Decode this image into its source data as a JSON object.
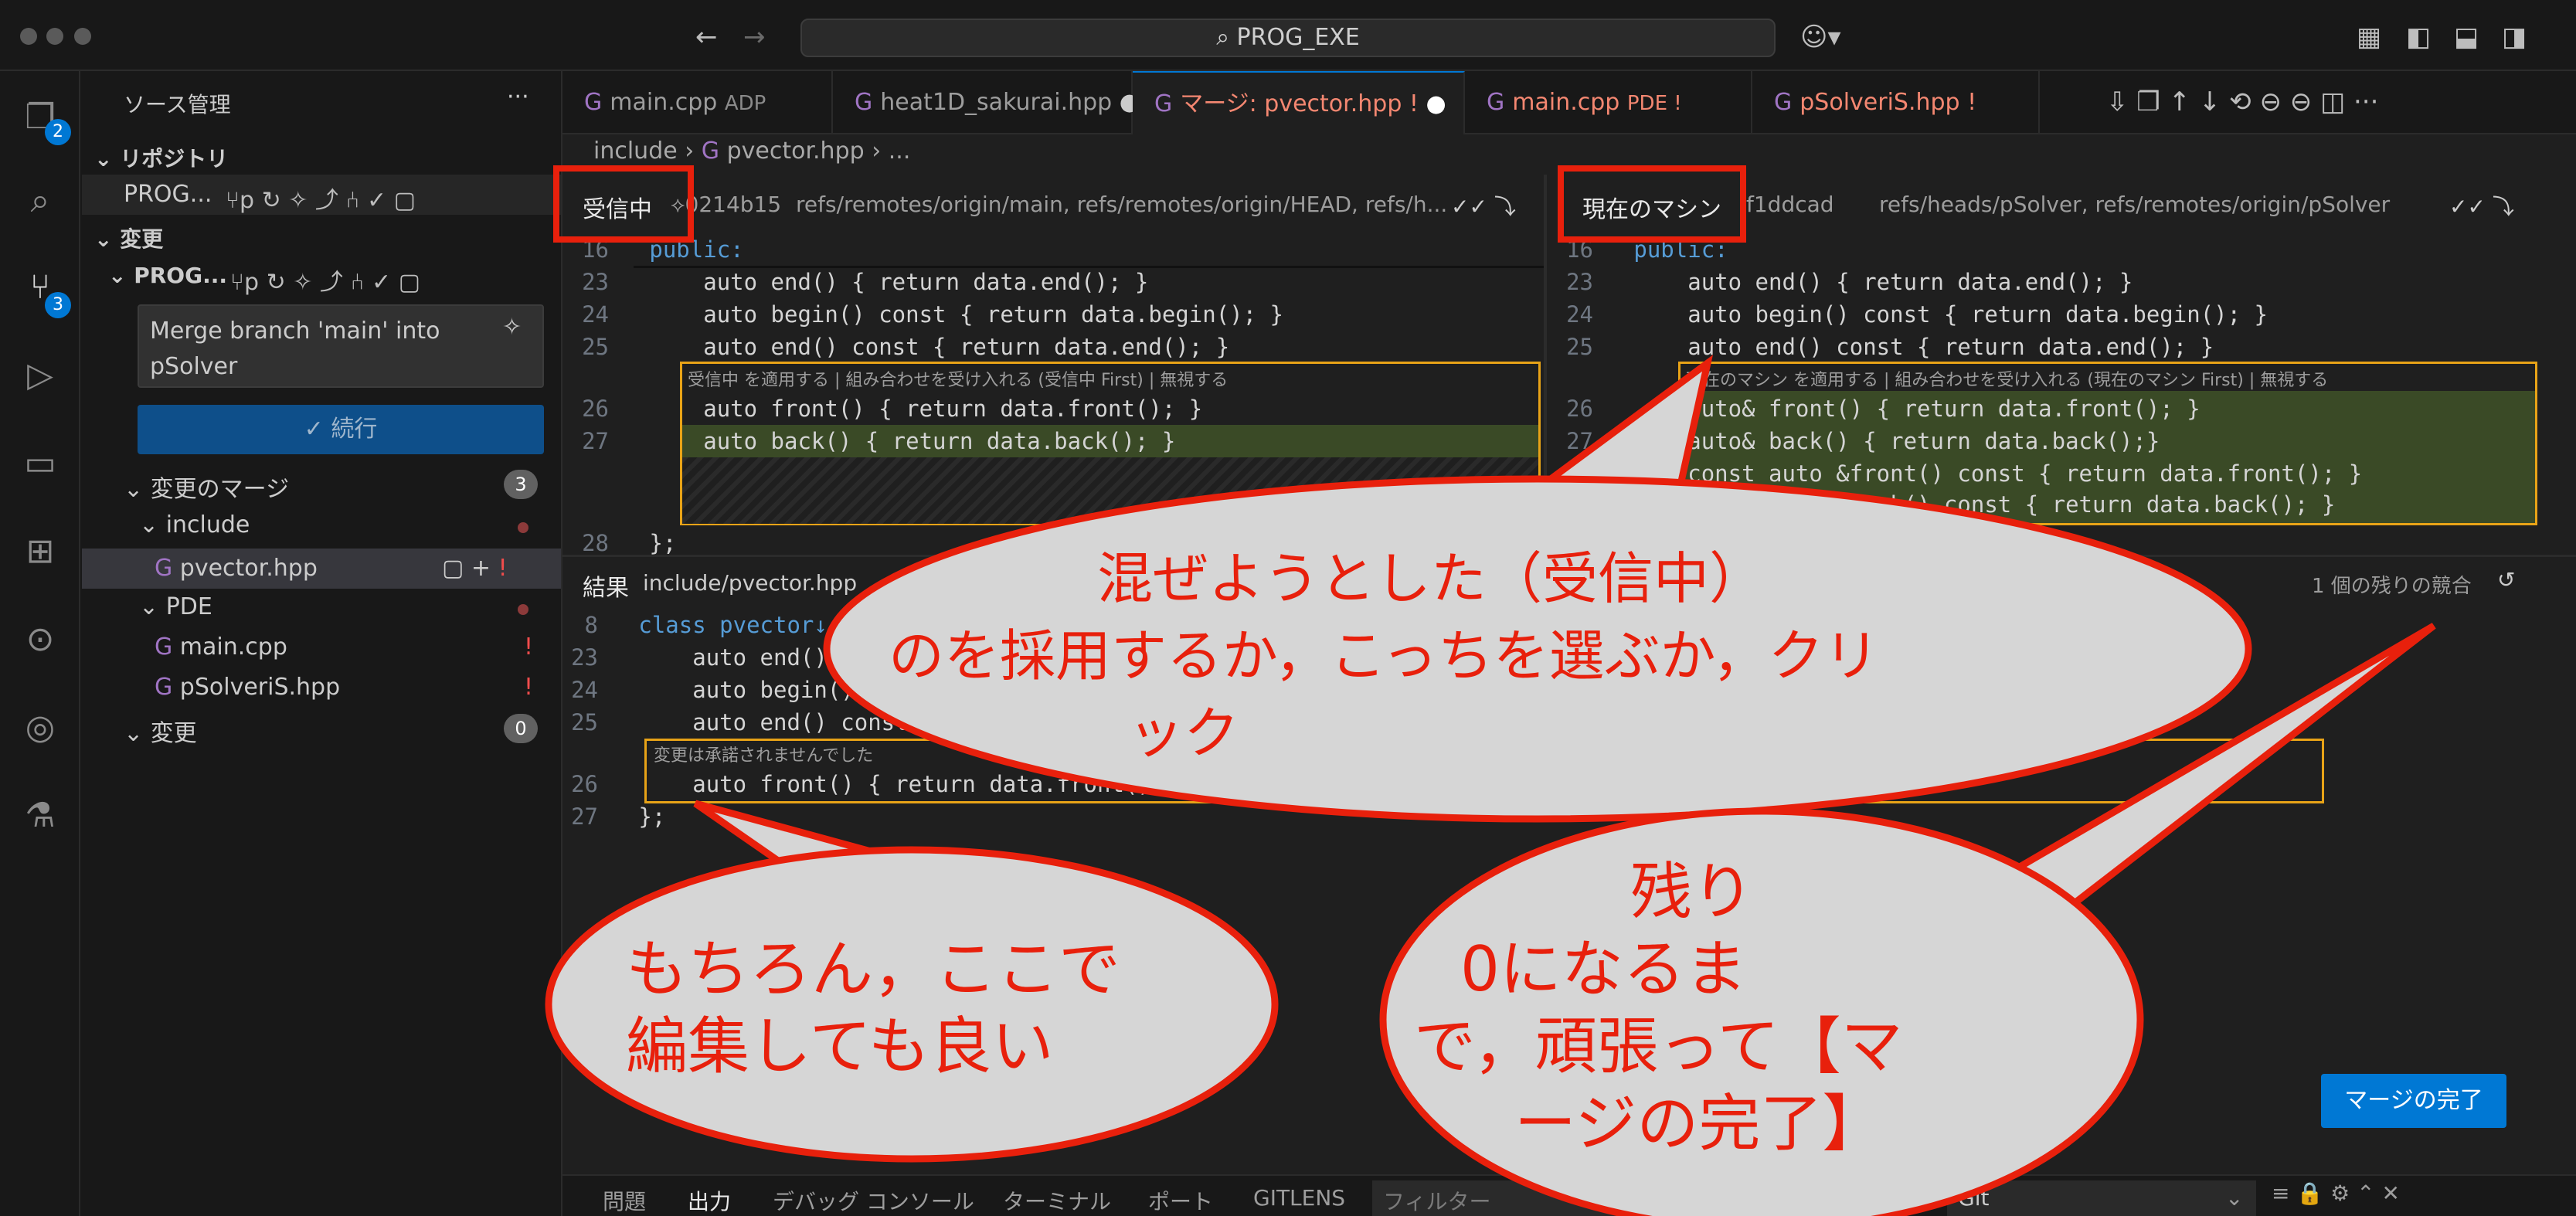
{
  "titlebar": {
    "search_text": "PROG_EXE"
  },
  "activity": {
    "explorer_badge": "2",
    "scm_badge": "3"
  },
  "sidebar": {
    "title": "ソース管理",
    "more": "···",
    "repos_header": "リポジトリ",
    "repo_name": "PROG...",
    "repo_branch": "p",
    "changes_header": "変更",
    "group_name": "PROG...",
    "group_branch": "p",
    "commit_message": "Merge branch 'main' into pSolver",
    "commit_button": "✓ 続行",
    "merge_changes_label": "変更のマージ",
    "merge_changes_count": "3",
    "folder_include": "include",
    "file_pvector": "pvector.hpp",
    "file_pvector_status": "!",
    "folder_pde": "PDE",
    "file_main": "main.cpp",
    "file_main_status": "!",
    "file_psolveris": "pSolveriS.hpp",
    "file_psolveris_status": "!",
    "changes_label": "変更",
    "changes_count": "0"
  },
  "tabs": [
    {
      "label": "main.cpp",
      "desc": "ADP"
    },
    {
      "label": "heat1D_sakurai.hpp",
      "desc": ""
    },
    {
      "label": "マージ: pvector.hpp",
      "desc": "!"
    },
    {
      "label": "main.cpp",
      "desc": "PDE !"
    },
    {
      "label": "pSolveriS.hpp",
      "desc": "!"
    }
  ],
  "breadcrumb": {
    "folder": "include",
    "file": "pvector.hpp",
    "rest": "..."
  },
  "incoming": {
    "title": "受信中",
    "commit": "0214b15",
    "refs": "refs/remotes/origin/main, refs/remotes/origin/HEAD, refs/h...",
    "codelens": "受信中 を適用する | 組み合わせを受け入れる (受信中 First) | 無視する",
    "lines": [
      {
        "n": "16",
        "code": "public:"
      },
      {
        "n": "23",
        "code": "    auto end() { return data.end(); }"
      },
      {
        "n": "24",
        "code": "    auto begin() const { return data.begin(); }"
      },
      {
        "n": "25",
        "code": "    auto end() const { return data.end(); }"
      },
      {
        "n": "26",
        "code": "    auto front() { return data.front(); }"
      },
      {
        "n": "27",
        "code": "    auto back() { return data.back(); }"
      },
      {
        "n": "28",
        "code": "};"
      }
    ]
  },
  "current": {
    "title": "現在のマシン",
    "commit": "f1ddcad",
    "refs": "refs/heads/pSolver, refs/remotes/origin/pSolver",
    "codelens": "現在のマシン を適用する | 組み合わせを受け入れる (現在のマシン First) | 無視する",
    "lines": [
      {
        "n": "16",
        "code": "public:"
      },
      {
        "n": "23",
        "code": "    auto end() { return data.end(); }"
      },
      {
        "n": "24",
        "code": "    auto begin() const { return data.begin(); }"
      },
      {
        "n": "25",
        "code": "    auto end() const { return data.end(); }"
      },
      {
        "n": "26",
        "code": "    auto& front() { return data.front(); }"
      },
      {
        "n": "27",
        "code": "    auto& back() { return data.back();}"
      },
      {
        "n": "28",
        "code": "    const auto &front() const { return data.front(); }"
      },
      {
        "n": "",
        "code": "    const auto &back() const { return data.back(); }"
      }
    ]
  },
  "result": {
    "title": "結果",
    "path": "include/pvector.hpp",
    "remaining": "1 個の残りの競合",
    "note": "変更は承諾されませんでした",
    "lines": [
      {
        "n": "8",
        "code": "class pvector↓"
      },
      {
        "n": "23",
        "code": "    auto end()"
      },
      {
        "n": "24",
        "code": "    auto begin()"
      },
      {
        "n": "25",
        "code": "    auto end() const"
      },
      {
        "n": "26",
        "code": "    auto front() { return data.front(); }"
      },
      {
        "n": "27",
        "code": "};"
      }
    ]
  },
  "merge_complete_button": "マージの完了",
  "panel": {
    "tabs": [
      "問題",
      "出力",
      "デバッグ コンソール",
      "ターミナル",
      "ポート",
      "GITLENS"
    ],
    "filter_placeholder": "フィルター",
    "dropdown": "Git"
  },
  "annotations": {
    "bubble1": [
      "混ぜようとした（受信中）",
      "のを採用するか，こっちを選ぶか，クリ",
      "ック"
    ],
    "bubble2": [
      "もちろん，ここで",
      "編集しても良い"
    ],
    "bubble3": [
      "残り",
      "0になるま",
      "で，頑張って【マ",
      "ージの完了】"
    ]
  }
}
